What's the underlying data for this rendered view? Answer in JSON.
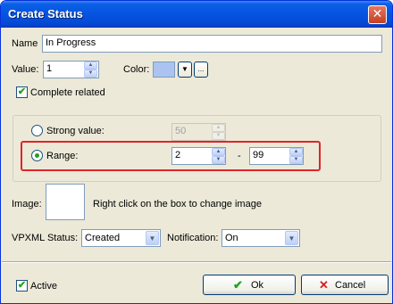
{
  "window": {
    "title": "Create Status",
    "close_glyph": "✕"
  },
  "name": {
    "label": "Name",
    "value": "In Progress"
  },
  "value_field": {
    "label": "Value:",
    "value": "1"
  },
  "color": {
    "label": "Color:",
    "swatch": "#aac3f1",
    "dropdown_glyph": "▼",
    "more_glyph": "..."
  },
  "complete_related": {
    "label": "Complete related",
    "checked": true
  },
  "strong_value": {
    "label": "Strong value:",
    "value": "50",
    "selected": false
  },
  "range": {
    "label": "Range:",
    "from": "2",
    "separator": "-",
    "to": "99",
    "selected": true
  },
  "image": {
    "label": "Image:",
    "hint": "Right click on the box to  change image"
  },
  "vpxml_status": {
    "label": "VPXML Status:",
    "selected": "Created"
  },
  "notification": {
    "label": "Notification:",
    "selected": "On"
  },
  "active": {
    "label": "Active",
    "checked": true
  },
  "buttons": {
    "ok": "Ok",
    "cancel": "Cancel"
  },
  "icons": {
    "ok": "check-icon",
    "cancel": "x-icon",
    "spin_up": "▲",
    "spin_down": "▼",
    "check": "✔"
  },
  "colors": {
    "title_bar": "#0554e0",
    "highlight": "#e0242b",
    "ok_icon": "#21a121",
    "cancel_icon": "#d81e1e"
  }
}
